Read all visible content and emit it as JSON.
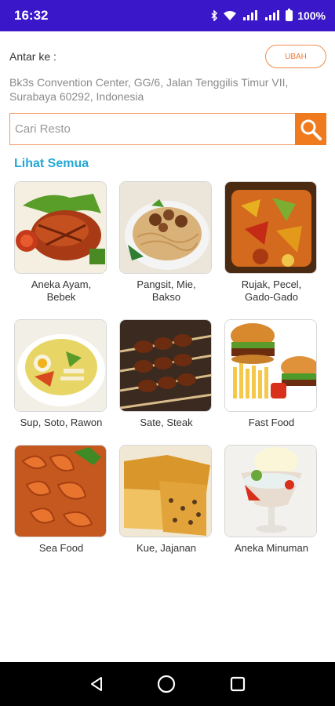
{
  "status_bar": {
    "time": "16:32",
    "battery": "100%"
  },
  "delivery": {
    "label": "Antar ke :",
    "change_button": "UBAH",
    "address": "Bk3s Convention Center, GG/6, Jalan Tenggilis Timur VII, Surabaya 60292, Indonesia"
  },
  "search": {
    "placeholder": "Cari Resto"
  },
  "see_all": "Lihat Semua",
  "categories": [
    {
      "line1": "Aneka Ayam,",
      "line2": "Bebek",
      "image": "grilled-chicken"
    },
    {
      "line1": "Pangsit, Mie,",
      "line2": "Bakso",
      "image": "noodles"
    },
    {
      "line1": "Rujak, Pecel,",
      "line2": "Gado-Gado",
      "image": "rujak"
    },
    {
      "line1": "Sup, Soto, Rawon",
      "line2": "",
      "image": "soup"
    },
    {
      "line1": "Sate, Steak",
      "line2": "",
      "image": "satay"
    },
    {
      "line1": "Fast Food",
      "line2": "",
      "image": "burger-fries"
    },
    {
      "line1": "Sea Food",
      "line2": "",
      "image": "shrimp"
    },
    {
      "line1": "Kue, Jajanan",
      "line2": "",
      "image": "cake"
    },
    {
      "line1": "Aneka Minuman",
      "line2": "",
      "image": "iced-drink"
    }
  ],
  "nav": {
    "back_icon": "back-triangle",
    "home_icon": "home-circle",
    "recents_icon": "recents-square"
  },
  "colors": {
    "status_bar": "#3a17c9",
    "accent_orange": "#f07a1e",
    "link_blue": "#22a7d6"
  }
}
